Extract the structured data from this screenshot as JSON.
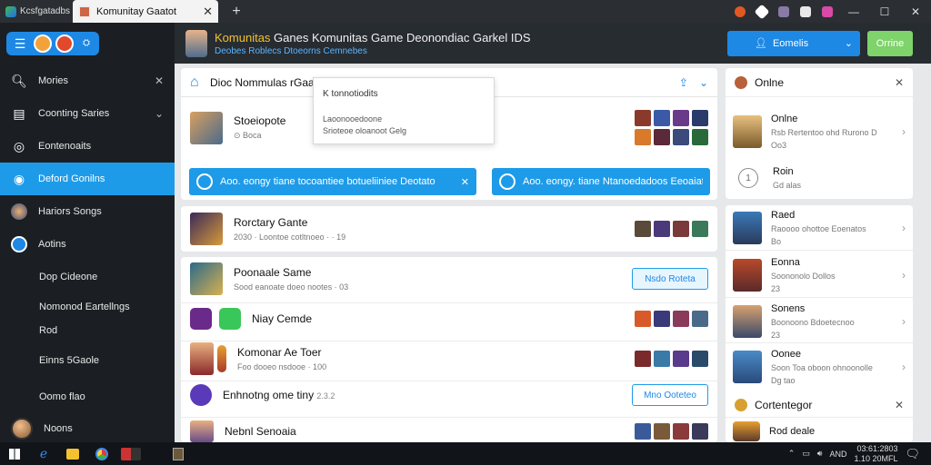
{
  "window": {
    "app_label": "Kcsfgatadbs",
    "tab_title": "Komunitay Gaatot",
    "tab_close": "✕",
    "new_tab": "+",
    "controls": [
      "—",
      "☐",
      "✕"
    ]
  },
  "sidebar": {
    "items": [
      {
        "label": "Mories",
        "icon": "search-icon",
        "trailing": "✕"
      },
      {
        "label": "Coonting Saries",
        "icon": "grid-icon",
        "trailing": "⌄"
      },
      {
        "label": "Eontenoaits",
        "icon": "coin-icon",
        "trailing": ""
      },
      {
        "label": "Deford Gonilns",
        "icon": "chat-icon",
        "trailing": "",
        "active": true
      },
      {
        "label": "Hariors Songs",
        "icon": "game-avatar-icon",
        "trailing": ""
      },
      {
        "label": "Aotins",
        "icon": "character-icon",
        "trailing": ""
      },
      {
        "label": "Dop Cideone",
        "icon": "",
        "trailing": ""
      },
      {
        "label": "Nomonod Eartellngs",
        "icon": "",
        "trailing": ""
      },
      {
        "label": "Rod",
        "icon": "",
        "trailing": ""
      },
      {
        "label": "Einns 5Gaole",
        "icon": "",
        "trailing": ""
      },
      {
        "label": "Oomo flao",
        "icon": "",
        "trailing": ""
      },
      {
        "label": "Noons",
        "icon": "user-avatar-icon",
        "trailing": ""
      }
    ]
  },
  "header": {
    "title_highlight": "Komunitas",
    "title_rest": " Ganes  Komunitas Game Deonondiac Garkel IDS",
    "subtitle": "Deobes Roblecs  Dtoeorns Cemnebes",
    "primary_button": "Eomelis",
    "primary_chevron": "⌄",
    "secondary_button": "Orrine"
  },
  "main": {
    "top_card": {
      "title": "Dioc Nommulas rGaao",
      "featured_title": "Stoeiopote",
      "featured_meta": "Boca",
      "dropdown": {
        "item1": "K tonnotiodits",
        "item2": "Laoonooedoone",
        "item3": "Srioteoe oloanoot Gelg"
      },
      "banner1": "Aoo. eongy tiane tocoantiee botueliiniee Deotato",
      "banner1_trail": "✕",
      "banner2": "Aoo. eongy. tiane Ntanoedadoos Eeoaiatoe"
    },
    "games": [
      {
        "title": "Rorctary Gante",
        "meta": "2030   ·   Loontoe cotltnoeo   ·  ·   19",
        "button": ""
      },
      {
        "title": "Poonaale Same",
        "meta": "Sood eanoate doeo nootes   ·   03",
        "button": "Nsdo Roteta"
      },
      {
        "title": "Niay Cemde",
        "meta": "",
        "button": ""
      },
      {
        "title": "Komonar Ae Toer",
        "meta": "Foo dooeo nsdooe   ·   100",
        "button": ""
      },
      {
        "title": "Enhnotng ome tiny",
        "meta": "2.3.2",
        "button": "Mno Ooteteo"
      },
      {
        "title": "Nebnl Senoaia",
        "meta": "",
        "button": ""
      }
    ]
  },
  "right_panel": {
    "title": "Onlne",
    "close": "✕",
    "items": [
      {
        "title": "Onlne",
        "meta": "Rsb Rertentoo ohd Rurono D",
        "sub": "Oo3"
      },
      {
        "title": "Roin",
        "meta": "",
        "sub": "Gd alas"
      },
      {
        "title": "Raed",
        "meta": "Raoooo ohottoe Eoenatos",
        "sub": "Bo"
      },
      {
        "title": "Eonna",
        "meta": "Soononolo Dollos",
        "sub": "23"
      },
      {
        "title": "Sonens",
        "meta": "Boonoono Bdoetecnoo",
        "sub": "23"
      },
      {
        "title": "Oonee",
        "meta": "Soon Toa oboon ohnoonolle",
        "sub": "Dg tao"
      }
    ],
    "bottom_title": "Cortentegor",
    "bottom_item": "Rod deale"
  },
  "taskbar": {
    "tray_text": "AND",
    "time": "03:61:2803",
    "date": "1.10 20MFL"
  },
  "colors": {
    "accent_blue": "#1e88e5",
    "accent_green": "#7ed36a",
    "sidebar_bg": "#1b1f23",
    "header_bg": "#272c31"
  }
}
